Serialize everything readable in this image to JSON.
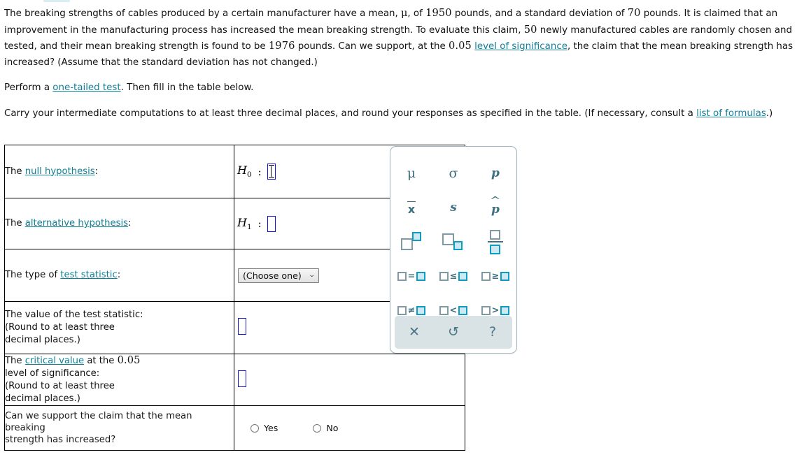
{
  "problem": {
    "paragraph1_parts": [
      {
        "t": "The breaking strengths of cables produced by a certain manufacturer have a mean, ",
        "k": "text"
      },
      {
        "t": "μ",
        "k": "mu"
      },
      {
        "t": ", of ",
        "k": "text"
      },
      {
        "t": "1950",
        "k": "num"
      },
      {
        "t": " pounds, and a standard deviation of ",
        "k": "text"
      },
      {
        "t": "70",
        "k": "num"
      },
      {
        "t": " pounds. It is claimed that an improvement in the manufacturing process has increased the mean breaking strength. To evaluate this claim, ",
        "k": "text"
      },
      {
        "t": "50",
        "k": "num"
      },
      {
        "t": " newly manufactured cables are randomly chosen and tested, and their mean breaking strength is found to be ",
        "k": "text"
      },
      {
        "t": "1976",
        "k": "num"
      },
      {
        "t": " pounds. Can we support, at the ",
        "k": "text"
      },
      {
        "t": "0.05",
        "k": "num"
      },
      {
        "t": " ",
        "k": "text"
      },
      {
        "t": "level of significance",
        "k": "link"
      },
      {
        "t": ", the claim that the mean breaking strength has increased? (Assume that the standard deviation has not changed.)",
        "k": "text"
      }
    ],
    "paragraph2_parts": [
      {
        "t": "Perform a ",
        "k": "text"
      },
      {
        "t": "one-tailed test",
        "k": "link"
      },
      {
        "t": ". Then fill in the table below.",
        "k": "text"
      }
    ],
    "paragraph3_parts": [
      {
        "t": "Carry your intermediate computations to at least three decimal places, and round your responses as specified in the table. (If necessary, consult a ",
        "k": "text"
      },
      {
        "t": "list of formulas",
        "k": "link"
      },
      {
        "t": ".)",
        "k": "text"
      }
    ],
    "mean_mu": "1950",
    "std_dev": "70",
    "sample_size": "50",
    "sample_mean": "1976",
    "alpha": "0.05"
  },
  "table": {
    "rows": [
      {
        "label_prefix": "The ",
        "label_link": "null hypothesis",
        "label_suffix": ":",
        "hypothesis_var": "H",
        "hypothesis_sub": "0",
        "colon": ":",
        "input_value": "",
        "input_state": "active"
      },
      {
        "label_prefix": "The ",
        "label_link": "alternative hypothesis",
        "label_suffix": ":",
        "hypothesis_var": "H",
        "hypothesis_sub": "1",
        "colon": ":",
        "input_value": "",
        "input_state": "idle"
      },
      {
        "label_prefix": "The type of ",
        "label_link": "test statistic",
        "label_suffix": ":",
        "select_value": "(Choose one)",
        "select_chevron": "⌄"
      },
      {
        "label_line1": "The value of the test statistic:",
        "label_line2": "(Round to at least three",
        "label_line3": "decimal places.)",
        "input_value": ""
      },
      {
        "label_prefix": "The ",
        "label_link": "critical value",
        "label_mid": " at the ",
        "label_alpha": "0.05",
        "label_line2": "level of significance:",
        "label_line3": "(Round to at least three",
        "label_line4": "decimal places.)",
        "input_value": ""
      },
      {
        "label_line1": "Can we support the claim that the mean breaking",
        "label_line2": "strength has increased?",
        "options": [
          {
            "label": "Yes",
            "selected": false
          },
          {
            "label": "No",
            "selected": false
          }
        ]
      }
    ]
  },
  "palette": {
    "symbols": [
      [
        {
          "name": "mu-symbol",
          "glyph": "μ",
          "kind": "glyph"
        },
        {
          "name": "sigma-symbol",
          "glyph": "σ",
          "kind": "glyph"
        },
        {
          "name": "p-symbol",
          "glyph": "p",
          "kind": "ital"
        }
      ],
      [
        {
          "name": "x-bar-symbol",
          "glyph": "x",
          "kind": "xbar"
        },
        {
          "name": "s-symbol",
          "glyph": "s",
          "kind": "ital"
        },
        {
          "name": "p-hat-symbol",
          "glyph": "p",
          "kind": "phat"
        }
      ],
      [
        {
          "name": "superscript-icon",
          "glyph": "",
          "kind": "sup"
        },
        {
          "name": "subscript-icon",
          "glyph": "",
          "kind": "sub"
        },
        {
          "name": "fraction-icon",
          "glyph": "",
          "kind": "frac"
        }
      ],
      [
        {
          "name": "equals-icon",
          "glyph": "=",
          "kind": "op"
        },
        {
          "name": "less-than-or-equal-icon",
          "glyph": "≤",
          "kind": "op"
        },
        {
          "name": "greater-than-or-equal-icon",
          "glyph": "≥",
          "kind": "op"
        }
      ],
      [
        {
          "name": "not-equals-icon",
          "glyph": "≠",
          "kind": "op"
        },
        {
          "name": "less-than-icon",
          "glyph": "<",
          "kind": "op"
        },
        {
          "name": "greater-than-icon",
          "glyph": ">",
          "kind": "op"
        }
      ]
    ],
    "footer": [
      {
        "name": "clear-icon",
        "glyph": "✕"
      },
      {
        "name": "undo-icon",
        "glyph": "↺"
      },
      {
        "name": "help-icon",
        "glyph": "?"
      }
    ]
  },
  "colors": {
    "link": "#128097",
    "input_border": "#1414d2",
    "palette_accent": "#0d9cc2",
    "palette_glyph": "#3f7080",
    "palette_border": "#9fb6bd",
    "palette_footer_bg": "#d9e3e5",
    "table_border": "#000000"
  }
}
